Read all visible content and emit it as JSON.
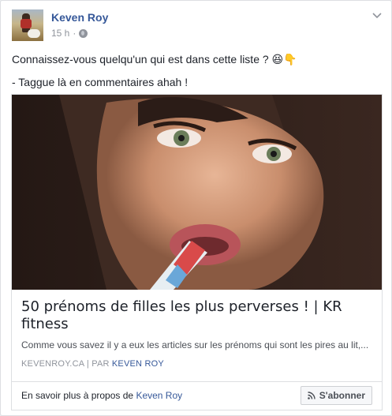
{
  "post": {
    "author": "Keven Roy",
    "time": "15 h",
    "separator": "·",
    "menu_icon": "chevron-down-icon",
    "privacy_icon": "globe-icon",
    "lines": [
      "Connaissez-vous quelqu'un qui est dans cette liste ? 😆👇",
      "- Taggue là en commentaires ahah !"
    ]
  },
  "link": {
    "title": "50 prénoms de filles les plus perverses ! | KR fitness",
    "description": "Comme vous savez il y a eux les articles sur les prénoms qui sont les pires au lit,...",
    "domain": "KEVENROY.CA",
    "by_prefix": "| PAR",
    "by_author": "KEVEN ROY"
  },
  "footer": {
    "learn_more": "En savoir plus à propos de",
    "page_name": "Keven Roy",
    "subscribe_label": "S'abonner",
    "subscribe_icon": "rss-icon"
  },
  "colors": {
    "link_blue": "#365899",
    "muted": "#90949c",
    "border": "#dddfe2"
  }
}
